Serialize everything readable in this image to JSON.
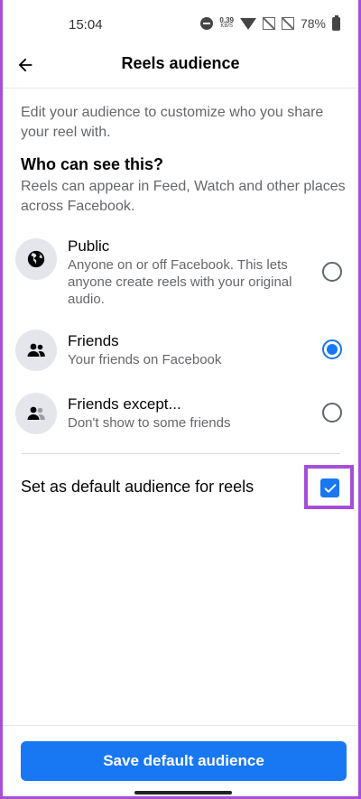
{
  "status_bar": {
    "time": "15:04",
    "speed_value": "0.39",
    "speed_unit": "KB/S",
    "battery": "78%"
  },
  "header": {
    "title": "Reels audience",
    "back_icon": "arrow-left-icon"
  },
  "intro": "Edit your audience to customize who you share your reel with.",
  "section": {
    "title": "Who can see this?",
    "description": "Reels can appear in Feed, Watch and other places across Facebook."
  },
  "options": [
    {
      "label": "Public",
      "description": "Anyone on or off Facebook. This lets anyone create reels with your original audio.",
      "icon": "globe-icon",
      "selected": false
    },
    {
      "label": "Friends",
      "description": "Your friends on Facebook",
      "icon": "friends-icon",
      "selected": true
    },
    {
      "label": "Friends except...",
      "description": "Don't show to some friends",
      "icon": "friends-except-icon",
      "selected": false
    }
  ],
  "default_setting": {
    "label": "Set as default audience for reels",
    "checked": true
  },
  "footer": {
    "save_label": "Save default audience"
  },
  "colors": {
    "accent": "#1877f2",
    "highlight": "#a64ed8",
    "secondary_text": "#65676b"
  }
}
